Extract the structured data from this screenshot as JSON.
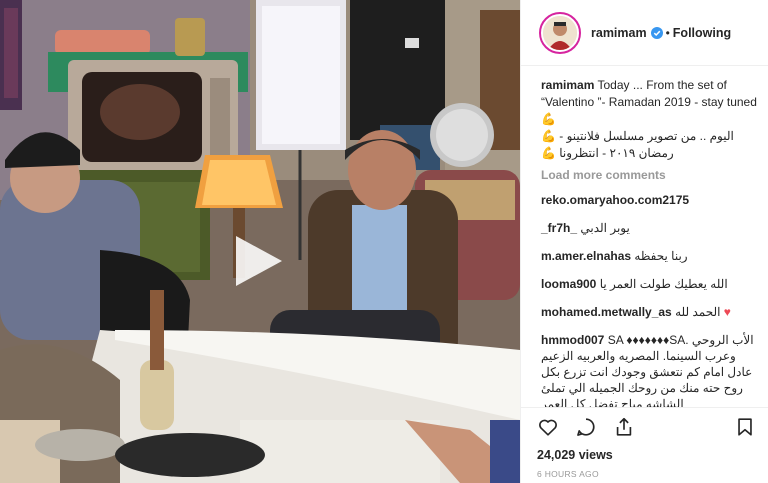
{
  "post": {
    "username": "ramimam",
    "follow_status": "Following",
    "caption_user": "ramimam",
    "caption_en": "Today ... From the set of “Valentino ”- Ramadan 2019 - stay tuned 💪",
    "caption_ar_1": "اليوم .. من تصوير مسلسل فلانتينو - 💪",
    "caption_ar_2": "رمضان ٢٠١٩ - انتظرونا 💪",
    "load_more": "Load more comments",
    "comments": [
      {
        "user": "reko.omaryahoo.com2175",
        "text": ""
      },
      {
        "user": "_fr7h_",
        "text": "يوبر الدبي"
      },
      {
        "user": "m.amer.elnahas",
        "text": "ربنا يحفظه"
      },
      {
        "user": "looma900",
        "text": "الله يعطيك طولت العمر يا"
      },
      {
        "user": "mohamed.metwally_as",
        "text": "الحمد لله"
      },
      {
        "user": "hmmod007",
        "text": "SA ♦♦♦♦♦♦♦SA. الأب الروحي وعرب السينما. المصريه والعربيه الزعيم عادل امام كم نتعشق وجودك انت تزرع بكل روح حته منك من روحك الجميله الي تملئ الشاشه مباح تفضل كل العمر"
      }
    ],
    "views": "24,029 views",
    "time": "6 HOURS AGO"
  },
  "icons": {
    "verified": "verified-badge-icon",
    "play": "play-icon",
    "like": "heart-icon",
    "comment": "comment-icon",
    "share": "share-icon",
    "save": "bookmark-icon"
  },
  "colors": {
    "verified_blue": "#3897f0",
    "heart_red": "#ed4956",
    "muted": "#999999",
    "text": "#262626"
  }
}
